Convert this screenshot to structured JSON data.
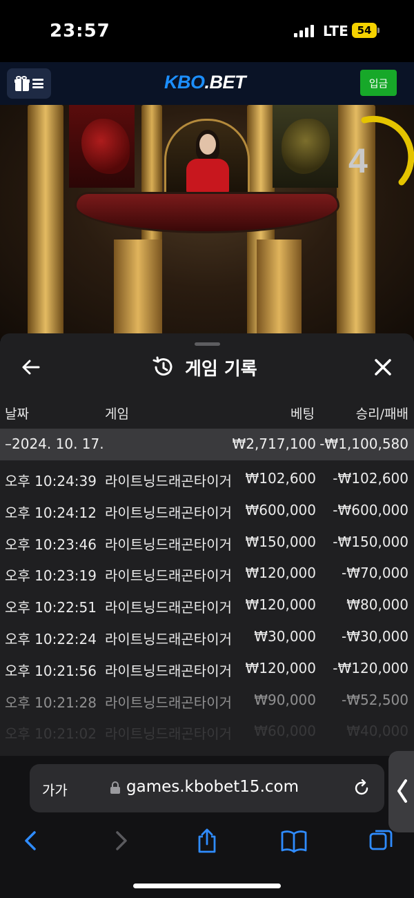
{
  "status_bar": {
    "time": "23:57",
    "network": "LTE",
    "battery": "54"
  },
  "header": {
    "logo_kbo": "KBO",
    "logo_bet": ".BET",
    "deposit_label": "입금"
  },
  "video": {
    "countdown": "4"
  },
  "panel": {
    "title": "게임 기록",
    "columns": {
      "date": "날짜",
      "game": "게임",
      "bet": "베팅",
      "result": "승리/패배"
    },
    "day_summary": {
      "date": "–2024. 10. 17.",
      "bet": "₩2,717,100",
      "result": "-₩1,100,580"
    },
    "rows": [
      {
        "time": "오후 10:24:39",
        "game": "라이트닝드래곤타이거",
        "bet": "₩102,600",
        "result": "-₩102,600"
      },
      {
        "time": "오후 10:24:12",
        "game": "라이트닝드래곤타이거",
        "bet": "₩600,000",
        "result": "-₩600,000"
      },
      {
        "time": "오후 10:23:46",
        "game": "라이트닝드래곤타이거",
        "bet": "₩150,000",
        "result": "-₩150,000"
      },
      {
        "time": "오후 10:23:19",
        "game": "라이트닝드래곤타이거",
        "bet": "₩120,000",
        "result": "-₩70,000"
      },
      {
        "time": "오후 10:22:51",
        "game": "라이트닝드래곤타이거",
        "bet": "₩120,000",
        "result": "₩80,000"
      },
      {
        "time": "오후 10:22:24",
        "game": "라이트닝드래곤타이거",
        "bet": "₩30,000",
        "result": "-₩30,000"
      },
      {
        "time": "오후 10:21:56",
        "game": "라이트닝드래곤타이거",
        "bet": "₩120,000",
        "result": "-₩120,000"
      },
      {
        "time": "오후 10:21:28",
        "game": "라이트닝드래곤타이거",
        "bet": "₩90,000",
        "result": "-₩52,500"
      },
      {
        "time": "오후 10:21:02",
        "game": "라이트닝드래곤타이거",
        "bet": "₩60,000",
        "result": "₩40,000"
      }
    ]
  },
  "browser": {
    "text_size_label": "가가",
    "url": "games.kbobet15.com"
  },
  "colors": {
    "brand_blue": "#1c8fff",
    "deposit_green": "#17a829",
    "panel_bg": "#1f1f21",
    "safari_blue": "#2f8cff"
  }
}
